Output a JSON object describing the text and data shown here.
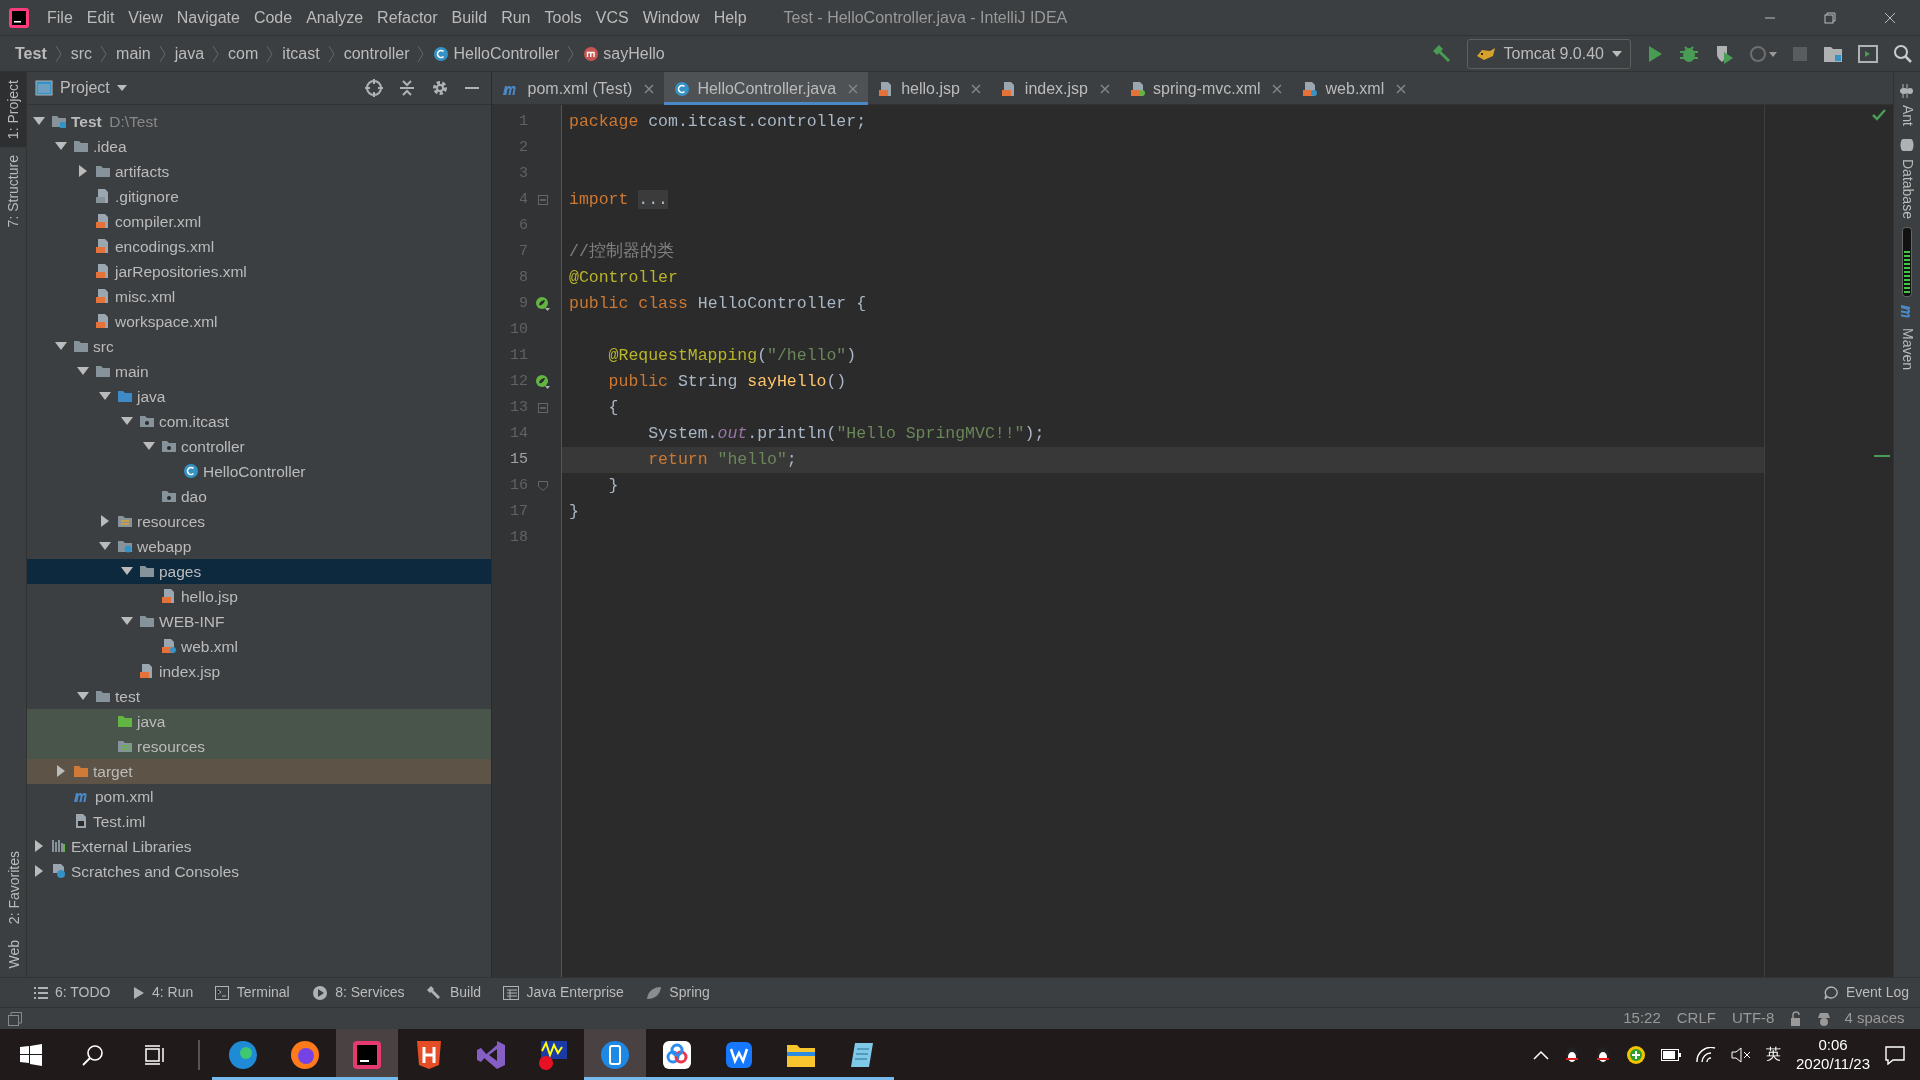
{
  "window": {
    "title": "Test - HelloController.java - IntelliJ IDEA"
  },
  "menu": [
    "File",
    "Edit",
    "View",
    "Navigate",
    "Code",
    "Analyze",
    "Refactor",
    "Build",
    "Run",
    "Tools",
    "VCS",
    "Window",
    "Help"
  ],
  "breadcrumbs": [
    {
      "label": "Test",
      "kind": "module"
    },
    {
      "label": "src",
      "kind": "folder"
    },
    {
      "label": "main",
      "kind": "folder"
    },
    {
      "label": "java",
      "kind": "folder"
    },
    {
      "label": "com",
      "kind": "folder"
    },
    {
      "label": "itcast",
      "kind": "folder"
    },
    {
      "label": "controller",
      "kind": "folder"
    },
    {
      "label": "HelloController",
      "kind": "class"
    },
    {
      "label": "sayHello",
      "kind": "method"
    }
  ],
  "run_config": {
    "label": "Tomcat 9.0.40"
  },
  "left_stripe": [
    {
      "label": "1: Project",
      "kind": "top",
      "selected": true
    },
    {
      "label": "7: Structure",
      "kind": "top",
      "selected": false
    },
    {
      "label": "2: Favorites",
      "kind": "bottom",
      "selected": false
    },
    {
      "label": "Web",
      "kind": "bottom",
      "selected": false
    }
  ],
  "project_panel": {
    "title": "Project",
    "tree": [
      {
        "label": "Test",
        "kind": "module",
        "path": "D:\\Test",
        "expanded": true,
        "selected": false,
        "children": [
          {
            "label": ".idea",
            "kind": "folder",
            "expanded": true,
            "selected": false,
            "children": [
              {
                "label": "artifacts",
                "kind": "folder",
                "expanded": false,
                "selected": false
              },
              {
                "label": ".gitignore",
                "kind": "ignore-file",
                "selected": false
              },
              {
                "label": "compiler.xml",
                "kind": "xml",
                "selected": false
              },
              {
                "label": "encodings.xml",
                "kind": "xml",
                "selected": false
              },
              {
                "label": "jarRepositories.xml",
                "kind": "xml",
                "selected": false
              },
              {
                "label": "misc.xml",
                "kind": "xml",
                "selected": false
              },
              {
                "label": "workspace.xml",
                "kind": "xml",
                "selected": false
              }
            ]
          },
          {
            "label": "src",
            "kind": "folder",
            "expanded": true,
            "selected": false,
            "children": [
              {
                "label": "main",
                "kind": "folder",
                "expanded": true,
                "selected": false,
                "children": [
                  {
                    "label": "java",
                    "kind": "source-folder",
                    "expanded": true,
                    "selected": false,
                    "children": [
                      {
                        "label": "com.itcast",
                        "kind": "package",
                        "expanded": true,
                        "selected": false,
                        "children": [
                          {
                            "label": "controller",
                            "kind": "package",
                            "expanded": true,
                            "selected": false,
                            "children": [
                              {
                                "label": "HelloController",
                                "kind": "class",
                                "selected": false
                              }
                            ]
                          },
                          {
                            "label": "dao",
                            "kind": "package",
                            "selected": false
                          }
                        ]
                      }
                    ]
                  },
                  {
                    "label": "resources",
                    "kind": "resource-folder",
                    "expanded": false,
                    "selected": false
                  },
                  {
                    "label": "webapp",
                    "kind": "web-folder",
                    "expanded": true,
                    "selected": false,
                    "children": [
                      {
                        "label": "pages",
                        "kind": "folder",
                        "expanded": true,
                        "selected": true,
                        "children": [
                          {
                            "label": "hello.jsp",
                            "kind": "jsp",
                            "selected": false
                          }
                        ]
                      },
                      {
                        "label": "WEB-INF",
                        "kind": "folder",
                        "expanded": true,
                        "selected": false,
                        "children": [
                          {
                            "label": "web.xml",
                            "kind": "web-xml",
                            "selected": false
                          }
                        ]
                      },
                      {
                        "label": "index.jsp",
                        "kind": "jsp",
                        "selected": false
                      }
                    ]
                  }
                ]
              },
              {
                "label": "test",
                "kind": "folder",
                "expanded": true,
                "selected": false,
                "children": [
                  {
                    "label": "java",
                    "kind": "test-source-folder",
                    "selected": false
                  },
                  {
                    "label": "resources",
                    "kind": "test-resource-folder",
                    "selected": false
                  }
                ]
              }
            ]
          },
          {
            "label": "target",
            "kind": "excluded-folder",
            "expanded": false,
            "selected": false
          },
          {
            "label": "pom.xml",
            "kind": "maven",
            "selected": false
          },
          {
            "label": "Test.iml",
            "kind": "iml",
            "selected": false
          }
        ]
      },
      {
        "label": "External Libraries",
        "kind": "libraries",
        "expanded": false,
        "selected": false
      },
      {
        "label": "Scratches and Consoles",
        "kind": "scratches",
        "expanded": false,
        "selected": false
      }
    ]
  },
  "tabs": [
    {
      "label": "pom.xml (Test)",
      "kind": "maven",
      "selected": false
    },
    {
      "label": "HelloController.java",
      "kind": "class",
      "selected": true
    },
    {
      "label": "hello.jsp",
      "kind": "jsp",
      "selected": false
    },
    {
      "label": "index.jsp",
      "kind": "jsp",
      "selected": false
    },
    {
      "label": "spring-mvc.xml",
      "kind": "spring-xml",
      "selected": false
    },
    {
      "label": "web.xml",
      "kind": "web-xml",
      "selected": false
    }
  ],
  "editor": {
    "lines": [
      {
        "number": "1",
        "kind": "code",
        "current": false,
        "tokens": [
          {
            "kind": "keyword",
            "text": "package"
          },
          {
            "kind": "plain",
            "text": " com.itcast.controller;"
          }
        ]
      },
      {
        "number": "2",
        "current": false
      },
      {
        "number": "3",
        "current": false
      },
      {
        "number": "4",
        "kind": "fold",
        "current": false,
        "tokens": [
          {
            "kind": "keyword",
            "text": "import "
          },
          {
            "kind": "folded",
            "text": "..."
          }
        ]
      },
      {
        "number": "6",
        "current": false
      },
      {
        "number": "7",
        "kind": "code",
        "current": false,
        "tokens": [
          {
            "kind": "comment",
            "text": "//控制器的类"
          }
        ]
      },
      {
        "number": "8",
        "kind": "code",
        "current": false,
        "tokens": [
          {
            "kind": "annotation",
            "text": "@Controller"
          }
        ]
      },
      {
        "number": "9",
        "kind": "bean",
        "current": false,
        "tokens": [
          {
            "kind": "keyword",
            "text": "public class"
          },
          {
            "kind": "plain",
            "text": " HelloController {"
          }
        ]
      },
      {
        "number": "10",
        "current": false
      },
      {
        "number": "11",
        "kind": "code",
        "current": false,
        "tokens": [
          {
            "kind": "annotation",
            "text": "    @RequestMapping"
          },
          {
            "kind": "plain",
            "text": "("
          },
          {
            "kind": "string",
            "text": "\"/hello\""
          },
          {
            "kind": "plain",
            "text": ")"
          }
        ]
      },
      {
        "number": "12",
        "kind": "bean",
        "current": false,
        "tokens": [
          {
            "kind": "keyword",
            "text": "    public"
          },
          {
            "kind": "plain",
            "text": " String "
          },
          {
            "kind": "declaration",
            "text": "sayHello"
          },
          {
            "kind": "plain",
            "text": "()"
          }
        ]
      },
      {
        "number": "13",
        "kind": "fold",
        "current": false,
        "tokens": [
          {
            "kind": "plain",
            "text": "    {"
          }
        ]
      },
      {
        "number": "14",
        "kind": "code",
        "current": false,
        "tokens": [
          {
            "kind": "plain",
            "text": "        System."
          },
          {
            "kind": "static",
            "text": "out"
          },
          {
            "kind": "plain",
            "text": ".println("
          },
          {
            "kind": "string",
            "text": "\"Hello SpringMVC!!\""
          },
          {
            "kind": "plain",
            "text": ");"
          }
        ]
      },
      {
        "number": "15",
        "kind": "code",
        "current": true,
        "tokens": [
          {
            "kind": "keyword",
            "text": "        return "
          },
          {
            "kind": "string",
            "text": "\"hello\""
          },
          {
            "kind": "plain",
            "text": ";"
          }
        ]
      },
      {
        "number": "16",
        "kind": "fold-end",
        "current": false,
        "tokens": [
          {
            "kind": "plain",
            "text": "    }"
          }
        ]
      },
      {
        "number": "17",
        "kind": "code",
        "current": false,
        "tokens": [
          {
            "kind": "plain",
            "text": "}"
          }
        ]
      },
      {
        "number": "18",
        "current": false
      }
    ]
  },
  "right_stripe": [
    {
      "label": "Ant",
      "kind": "ant"
    },
    {
      "label": "Database",
      "kind": "database"
    },
    {
      "label": "Maven",
      "kind": "maven"
    }
  ],
  "tool_windows": [
    {
      "label": "6: TODO",
      "kind": "todo"
    },
    {
      "label": "4: Run",
      "kind": "run"
    },
    {
      "label": "Terminal",
      "kind": "terminal"
    },
    {
      "label": "8: Services",
      "kind": "services"
    },
    {
      "label": "Build",
      "kind": "build"
    },
    {
      "label": "Java Enterprise",
      "kind": "enterprise"
    },
    {
      "label": "Spring",
      "kind": "spring"
    }
  ],
  "event_log": {
    "label": "Event Log"
  },
  "status_bar": {
    "position": "15:22",
    "line_separator": "CRLF",
    "encoding": "UTF-8",
    "indent": "4 spaces"
  },
  "taskbar": {
    "apps": [
      {
        "kind": "edge",
        "running": true,
        "selected": false
      },
      {
        "kind": "firefox",
        "running": true,
        "selected": false
      },
      {
        "kind": "intellij",
        "running": true,
        "selected": true
      },
      {
        "kind": "html",
        "running": false,
        "selected": false
      },
      {
        "kind": "visual-studio",
        "running": false,
        "selected": false
      },
      {
        "kind": "wave",
        "running": false,
        "selected": false
      },
      {
        "kind": "phone",
        "running": true,
        "selected": true
      },
      {
        "kind": "cloud",
        "running": true,
        "selected": false
      },
      {
        "kind": "office",
        "running": true,
        "selected": false
      },
      {
        "kind": "explorer",
        "running": true,
        "selected": false
      },
      {
        "kind": "notepad",
        "running": true,
        "selected": false
      }
    ],
    "ime": "英",
    "time": "0:06",
    "date": "2020/11/23"
  }
}
